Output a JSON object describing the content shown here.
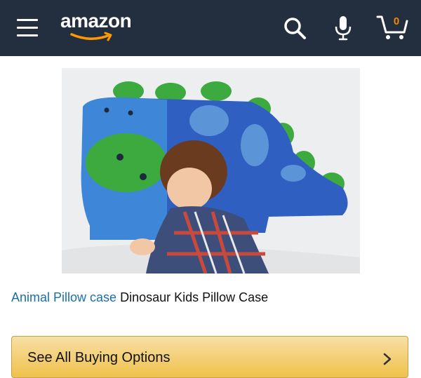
{
  "header": {
    "logo_text": "amazon",
    "cart_count": "0",
    "icons": {
      "menu": "hamburger-menu-icon",
      "search": "search-icon",
      "mic": "microphone-icon",
      "cart": "cart-icon"
    },
    "colors": {
      "bar": "#232f3e",
      "logo_smile": "#f90",
      "cart_count": "#f08804"
    }
  },
  "product": {
    "brand": "Animal Pillow case",
    "title": "Dinosaur Kids Pillow Case"
  },
  "actions": {
    "buy_options_label": "See All Buying Options"
  },
  "colors": {
    "link": "#1a6fa8",
    "button_gradient": [
      "#f7dfa5",
      "#f0c14b"
    ]
  }
}
